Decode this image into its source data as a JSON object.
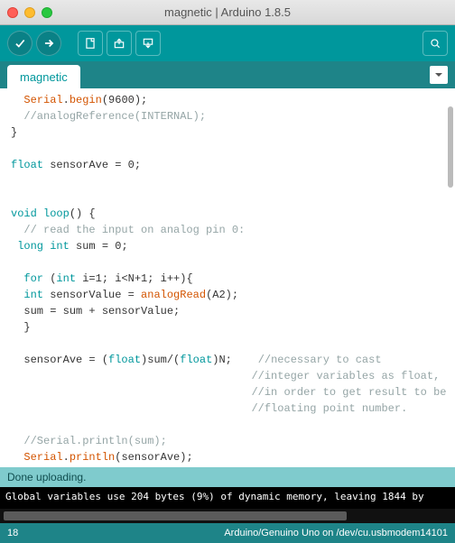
{
  "window": {
    "title": "magnetic | Arduino 1.8.5"
  },
  "tabs": [
    {
      "label": "magnetic"
    }
  ],
  "code": {
    "l1a": "Serial",
    "l1b": ".",
    "l1c": "begin",
    "l1d": "(9600);",
    "l2": "//analogReference(INTERNAL);",
    "l3": "}",
    "l4a": "float",
    "l4b": " sensorAve = 0;",
    "l5a": "void",
    "l5b": " ",
    "l5c": "loop",
    "l5d": "() {",
    "l6": "// read the input on analog pin 0:",
    "l7a": "long",
    "l7b": " ",
    "l7c": "int",
    "l7d": " sum = 0;",
    "l8a": "for",
    "l8b": " (",
    "l8c": "int",
    "l8d": " i=1; i<N+1; i++){",
    "l9a": "int",
    "l9b": " sensorValue = ",
    "l9c": "analogRead",
    "l9d": "(A2);",
    "l10": "sum = sum + sensorValue;",
    "l11": "}",
    "l12a": "sensorAve = (",
    "l12b": "float",
    "l12c": ")sum/(",
    "l12d": "float",
    "l12e": ")N;    ",
    "l12f": "//necessary to cast",
    "l13": "//integer variables as float,",
    "l14": "//in order to get result to be",
    "l15": "//floating point number.",
    "l16": "//Serial.println(sum);",
    "l17a": "Serial",
    "l17b": ".",
    "l17c": "println",
    "l17d": "(sensorAve);",
    "l18": "}"
  },
  "status": {
    "text": "Done uploading."
  },
  "console": {
    "line": "Global variables use 204 bytes (9%) of dynamic memory, leaving 1844 by"
  },
  "footer": {
    "line": "18",
    "board": "Arduino/Genuino Uno on /dev/cu.usbmodem14101"
  }
}
